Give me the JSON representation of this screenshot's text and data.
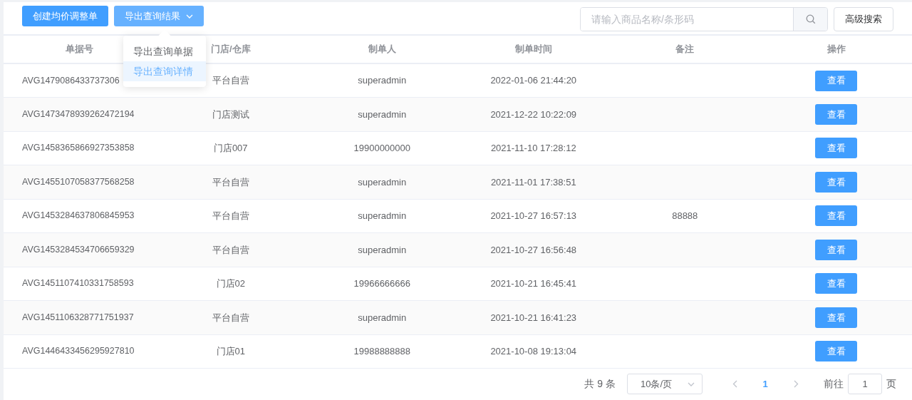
{
  "toolbar": {
    "buttons": [
      {
        "label": "创建均价调整单",
        "kind": "primary",
        "expanded": false
      },
      {
        "label": "导出查询结果",
        "kind": "dropdown",
        "expanded": true
      }
    ],
    "search": {
      "placeholder": "请输入商品名称/条形码"
    },
    "advanced_button": "高级搜索"
  },
  "dropdown_menu": {
    "items": [
      {
        "label": "导出查询单据",
        "selected": false
      },
      {
        "label": "导出查询详情",
        "selected": true
      }
    ]
  },
  "table": {
    "columns": [
      "单据号",
      "门店/仓库",
      "制单人",
      "制单时间",
      "备注",
      "操作"
    ],
    "rows": [
      {
        "doc_no": "AVG1479086433737306",
        "store": "平台自营",
        "creator": "superadmin",
        "time": "2022-01-06 21:44:20",
        "action": "查看"
      },
      {
        "doc_no": "AVG1473478939262472194",
        "store": "门店测试",
        "creator": "superadmin",
        "time": "2021-12-22 10:22:09",
        "action": "查看"
      },
      {
        "doc_no": "AVG1458365866927353858",
        "store": "门店007",
        "creator": "19900000000",
        "time": "2021-11-10 17:28:12",
        "action": "查看"
      },
      {
        "doc_no": "AVG1455107058377568258",
        "store": "平台自营",
        "creator": "superadmin",
        "time": "2021-11-01 17:38:51",
        "action": "查看"
      },
      {
        "doc_no": "AVG1453284637806845953",
        "store": "平台自营",
        "creator": "superadmin",
        "time": "2021-10-27 16:57:13",
        "note": "88888",
        "action": "查看"
      },
      {
        "doc_no": "AVG1453284534706659329",
        "store": "平台自营",
        "creator": "superadmin",
        "time": "2021-10-27 16:56:48",
        "action": "查看"
      },
      {
        "doc_no": "AVG1451107410331758593",
        "store": "门店02",
        "creator": "19966666666",
        "time": "2021-10-21 16:45:41",
        "action": "查看"
      },
      {
        "doc_no": "AVG1451106328771751937",
        "store": "平台自营",
        "creator": "superadmin",
        "time": "2021-10-21 16:41:23",
        "action": "查看"
      },
      {
        "doc_no": "AVG1446433456295927810",
        "store": "门店01",
        "creator": "19988888888",
        "time": "2021-10-08 19:13:04",
        "action": "查看"
      }
    ]
  },
  "pagination": {
    "total": "共 9 条",
    "page_size": "10条/页",
    "prev": {
      "disabled": true
    },
    "pages": [
      {
        "label": "1",
        "selected": true
      }
    ],
    "next": {
      "disabled": true
    },
    "goto_label": "前往",
    "goto_value": "1",
    "goto_suffix": "页"
  }
}
